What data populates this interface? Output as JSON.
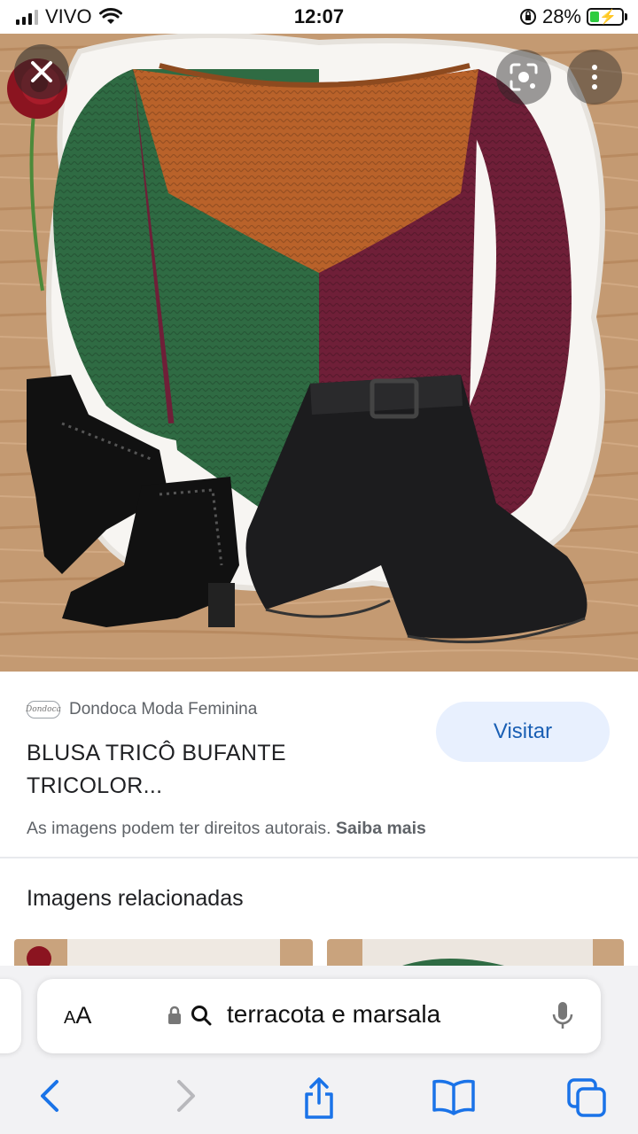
{
  "status_bar": {
    "carrier": "VIVO",
    "time": "12:07",
    "battery_percent": "28%",
    "battery_level": 0.28
  },
  "image_viewer": {
    "close_icon": "close-icon",
    "lens_icon": "google-lens-icon",
    "more_icon": "more-vertical-icon"
  },
  "result": {
    "source_name": "Dondoca Moda Feminina",
    "source_logo_text": "Dondoca",
    "title_line1": "BLUSA TRICÔ BUFANTE",
    "title_line2": "TRICOLOR...",
    "visit_label": "Visitar",
    "copyright_text": "As imagens podem ter direitos autorais.",
    "learn_more": "Saiba mais"
  },
  "related": {
    "title": "Imagens relacionadas"
  },
  "browser": {
    "text_size_label_big": "A",
    "text_size_label_small": "A",
    "text_size_label_prefix": "A",
    "address_text": "terracota e marsala",
    "toolbar": {
      "back_icon": "back-chevron-icon",
      "forward_icon": "forward-chevron-icon",
      "share_icon": "share-icon",
      "bookmarks_icon": "book-icon",
      "tabs_icon": "tabs-icon"
    }
  },
  "colors": {
    "visit_button_bg": "#e8f0fe",
    "visit_button_text": "#1a5fb4",
    "ios_blue": "#1a73e8",
    "sweater_green": "#2f6b43",
    "sweater_orange": "#b9622a",
    "sweater_burgundy": "#6f1f38"
  }
}
